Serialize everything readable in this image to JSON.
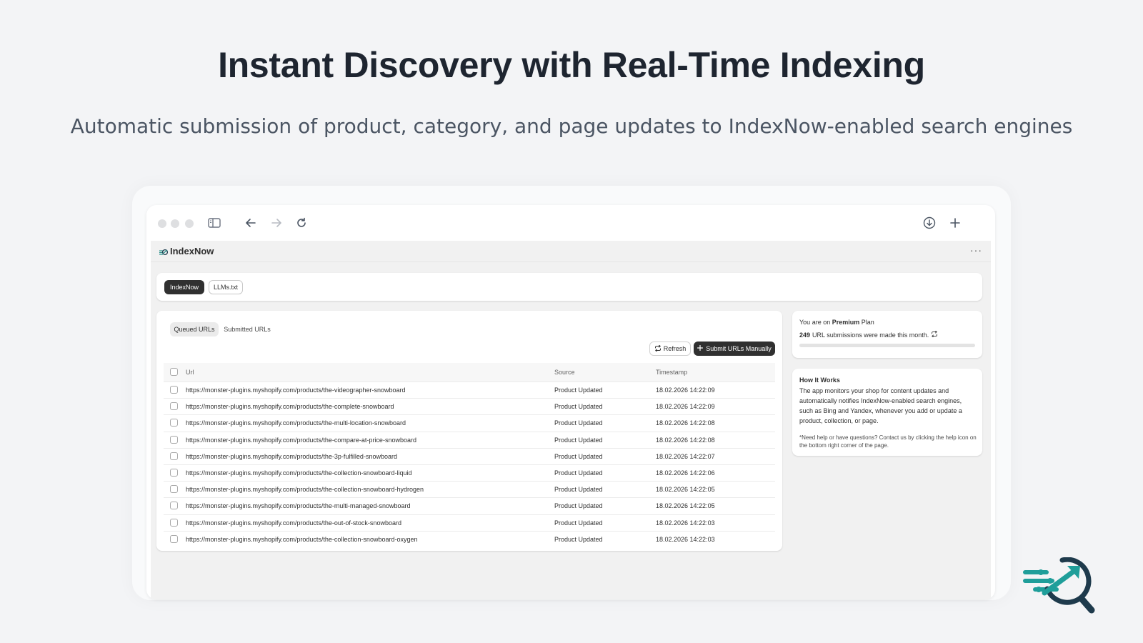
{
  "hero": {
    "title": "Instant Discovery with Real-Time Indexing",
    "subtitle": "Automatic submission of product, category, and page updates to IndexNow-enabled search engines"
  },
  "browser": {
    "icons": [
      "sidebar-icon",
      "back-arrow-icon",
      "forward-arrow-icon",
      "reload-icon",
      "download-icon",
      "plus-icon"
    ]
  },
  "app": {
    "name": "IndexNow",
    "more_label": "···",
    "tabs": [
      {
        "label": "IndexNow",
        "active": true
      },
      {
        "label": "LLMs.txt",
        "active": false
      }
    ],
    "segments": [
      {
        "label": "Queued URLs",
        "active": true
      },
      {
        "label": "Submitted URLs",
        "active": false
      }
    ],
    "actions": {
      "refresh_label": "Refresh",
      "submit_label": "Submit URLs Manually"
    },
    "table": {
      "columns": [
        "Url",
        "Source",
        "Timestamp"
      ],
      "rows": [
        {
          "url": "https://monster-plugins.myshopify.com/products/the-videographer-snowboard",
          "source": "Product Updated",
          "timestamp": "18.02.2026 14:22:09"
        },
        {
          "url": "https://monster-plugins.myshopify.com/products/the-complete-snowboard",
          "source": "Product Updated",
          "timestamp": "18.02.2026 14:22:09"
        },
        {
          "url": "https://monster-plugins.myshopify.com/products/the-multi-location-snowboard",
          "source": "Product Updated",
          "timestamp": "18.02.2026 14:22:08"
        },
        {
          "url": "https://monster-plugins.myshopify.com/products/the-compare-at-price-snowboard",
          "source": "Product Updated",
          "timestamp": "18.02.2026 14:22:08"
        },
        {
          "url": "https://monster-plugins.myshopify.com/products/the-3p-fulfilled-snowboard",
          "source": "Product Updated",
          "timestamp": "18.02.2026 14:22:07"
        },
        {
          "url": "https://monster-plugins.myshopify.com/products/the-collection-snowboard-liquid",
          "source": "Product Updated",
          "timestamp": "18.02.2026 14:22:06"
        },
        {
          "url": "https://monster-plugins.myshopify.com/products/the-collection-snowboard-hydrogen",
          "source": "Product Updated",
          "timestamp": "18.02.2026 14:22:05"
        },
        {
          "url": "https://monster-plugins.myshopify.com/products/the-multi-managed-snowboard",
          "source": "Product Updated",
          "timestamp": "18.02.2026 14:22:05"
        },
        {
          "url": "https://monster-plugins.myshopify.com/products/the-out-of-stock-snowboard",
          "source": "Product Updated",
          "timestamp": "18.02.2026 14:22:03"
        },
        {
          "url": "https://monster-plugins.myshopify.com/products/the-collection-snowboard-oxygen",
          "source": "Product Updated",
          "timestamp": "18.02.2026 14:22:03"
        }
      ]
    },
    "plan": {
      "prefix": "You are on",
      "plan_name": "Premium",
      "suffix": "Plan",
      "count": "249",
      "count_text": "URL submissions were made this month.",
      "usage_fraction": 0
    },
    "how_it_works": {
      "title": "How It Works",
      "body": "The app monitors your shop for content updates and automatically notifies IndexNow-enabled search engines, such as Bing and Yandex, whenever you add or update a product, collection, or page.",
      "note": "*Need help or have questions? Contact us by clicking the help icon on the bottom right corner of the page."
    }
  },
  "colors": {
    "page_bg": "#f3f4f6",
    "title": "#1e2530",
    "primary_button": "#303030",
    "brand_teal": "#1f9e9a",
    "brand_dark": "#1e3a4c"
  }
}
